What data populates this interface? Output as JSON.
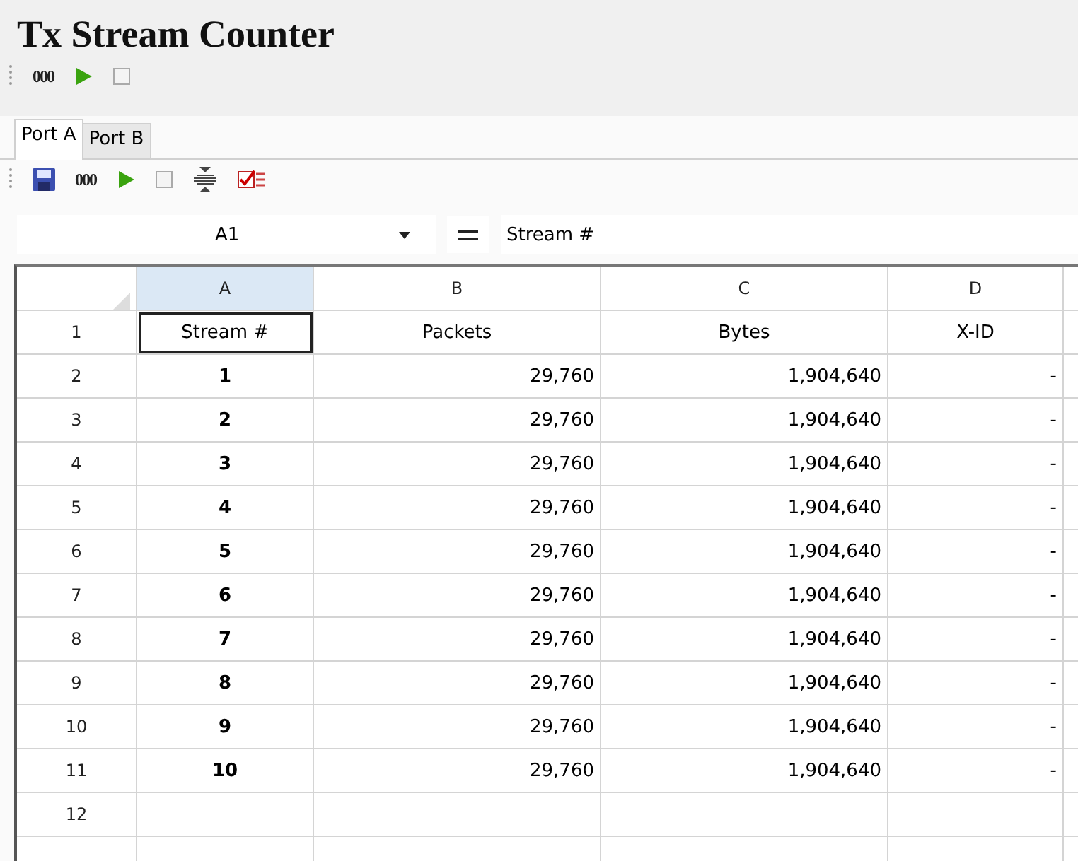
{
  "title": "Tx Stream Counter",
  "toolbar": [
    {
      "kind": "counter",
      "label": "000"
    },
    {
      "kind": "play"
    },
    {
      "kind": "stop"
    }
  ],
  "tabs": [
    {
      "label": "Port A",
      "selected": true
    },
    {
      "label": "Port B",
      "selected": false
    }
  ],
  "port_toolbar": [
    {
      "kind": "save"
    },
    {
      "kind": "counter",
      "label": "000"
    },
    {
      "kind": "play"
    },
    {
      "kind": "stop"
    },
    {
      "kind": "spacing"
    },
    {
      "kind": "checklist"
    }
  ],
  "name_box": "A1",
  "formula": "Stream #",
  "columns": [
    {
      "label": "A",
      "selected": true
    },
    {
      "label": "B",
      "selected": false
    },
    {
      "label": "C",
      "selected": false
    },
    {
      "label": "D",
      "selected": false
    }
  ],
  "rows": [
    {
      "header": "1",
      "kind": "labels",
      "cells": [
        {
          "text": "Stream #",
          "selected": true
        },
        {
          "text": "Packets",
          "selected": false
        },
        {
          "text": "Bytes",
          "selected": false
        },
        {
          "text": "X-ID",
          "selected": false
        }
      ]
    },
    {
      "header": "2",
      "kind": "data",
      "cells": [
        "1",
        "29,760",
        "1,904,640",
        "-"
      ]
    },
    {
      "header": "3",
      "kind": "data",
      "cells": [
        "2",
        "29,760",
        "1,904,640",
        "-"
      ]
    },
    {
      "header": "4",
      "kind": "data",
      "cells": [
        "3",
        "29,760",
        "1,904,640",
        "-"
      ]
    },
    {
      "header": "5",
      "kind": "data",
      "cells": [
        "4",
        "29,760",
        "1,904,640",
        "-"
      ]
    },
    {
      "header": "6",
      "kind": "data",
      "cells": [
        "5",
        "29,760",
        "1,904,640",
        "-"
      ]
    },
    {
      "header": "7",
      "kind": "data",
      "cells": [
        "6",
        "29,760",
        "1,904,640",
        "-"
      ]
    },
    {
      "header": "8",
      "kind": "data",
      "cells": [
        "7",
        "29,760",
        "1,904,640",
        "-"
      ]
    },
    {
      "header": "9",
      "kind": "data",
      "cells": [
        "8",
        "29,760",
        "1,904,640",
        "-"
      ]
    },
    {
      "header": "10",
      "kind": "data",
      "cells": [
        "9",
        "29,760",
        "1,904,640",
        "-"
      ]
    },
    {
      "header": "11",
      "kind": "data",
      "cells": [
        "10",
        "29,760",
        "1,904,640",
        "-"
      ]
    },
    {
      "header": "12",
      "kind": "empty"
    }
  ]
}
